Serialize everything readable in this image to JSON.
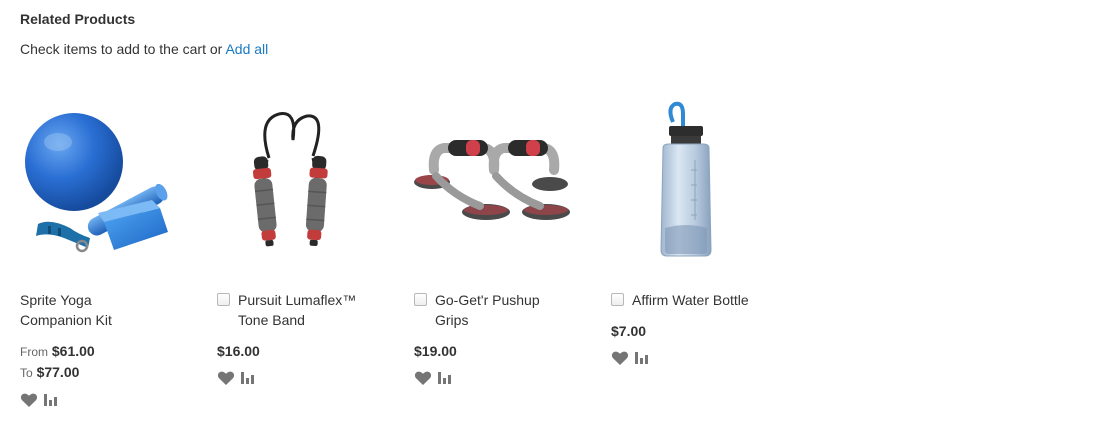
{
  "header": {
    "title": "Related Products",
    "instructions": "Check items to add to the cart or",
    "add_all_link": "Add all"
  },
  "products": [
    {
      "name": "Sprite Yoga Companion Kit",
      "name_line1": "Sprite Yoga",
      "name_line2": "Companion Kit",
      "has_checkbox": false,
      "price_from_label": "From",
      "price_from": "$61.00",
      "price_to_label": "To",
      "price_to": "$77.00",
      "image_icon": "yoga-kit-image"
    },
    {
      "name": "Pursuit Lumaflex™ Tone Band",
      "name_line1": "Pursuit Lumaflex™",
      "name_line2": "Tone Band",
      "has_checkbox": true,
      "price": "$16.00",
      "image_icon": "jump-rope-image"
    },
    {
      "name": "Go-Get'r Pushup Grips",
      "name_line1": "Go-Get'r Pushup",
      "name_line2": "Grips",
      "has_checkbox": true,
      "price": "$19.00",
      "image_icon": "pushup-grips-image"
    },
    {
      "name": "Affirm Water Bottle",
      "name_line1": "Affirm Water Bottle",
      "has_checkbox": true,
      "price": "$7.00",
      "image_icon": "water-bottle-image"
    }
  ],
  "icons": {
    "wishlist": "heart-icon",
    "compare": "bar-chart-icon"
  },
  "colors": {
    "link": "#1979c3",
    "text": "#333333",
    "icon": "#757575"
  }
}
